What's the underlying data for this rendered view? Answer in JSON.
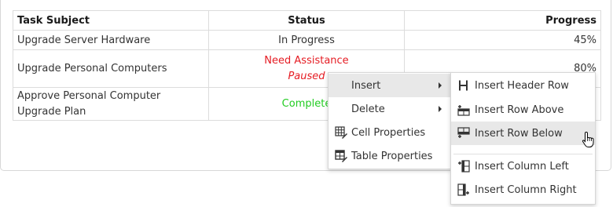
{
  "table": {
    "headers": [
      "Task Subject",
      "Status",
      "Progress"
    ],
    "rows": [
      {
        "subject": "Upgrade Server Hardware",
        "status": "In Progress",
        "progress": "45%"
      },
      {
        "subject": "Upgrade Personal Computers",
        "status": "Need Assistance",
        "status_note": "Paused",
        "progress": "80%"
      },
      {
        "subject": "Approve Personal Computer Upgrade Plan",
        "status": "Complete",
        "progress": ""
      }
    ]
  },
  "context_menu": {
    "items": [
      {
        "label": "Insert",
        "icon": "none",
        "has_submenu": true
      },
      {
        "label": "Delete",
        "icon": "none",
        "has_submenu": true
      },
      {
        "label": "Cell Properties",
        "icon": "cell-properties-icon"
      },
      {
        "label": "Table Properties",
        "icon": "table-properties-icon"
      }
    ]
  },
  "insert_submenu": {
    "items": [
      {
        "label": "Insert Header Row",
        "icon": "header-row-icon"
      },
      {
        "label": "Insert Row Above",
        "icon": "insert-row-above-icon"
      },
      {
        "label": "Insert Row Below",
        "icon": "insert-row-below-icon"
      },
      {
        "label": "Insert Column Left",
        "icon": "insert-column-left-icon"
      },
      {
        "label": "Insert Column Right",
        "icon": "insert-column-right-icon"
      }
    ]
  },
  "colors": {
    "need_assistance": "#e51c23",
    "complete": "#22cc22",
    "menu_highlight": "#e8e8e8"
  }
}
